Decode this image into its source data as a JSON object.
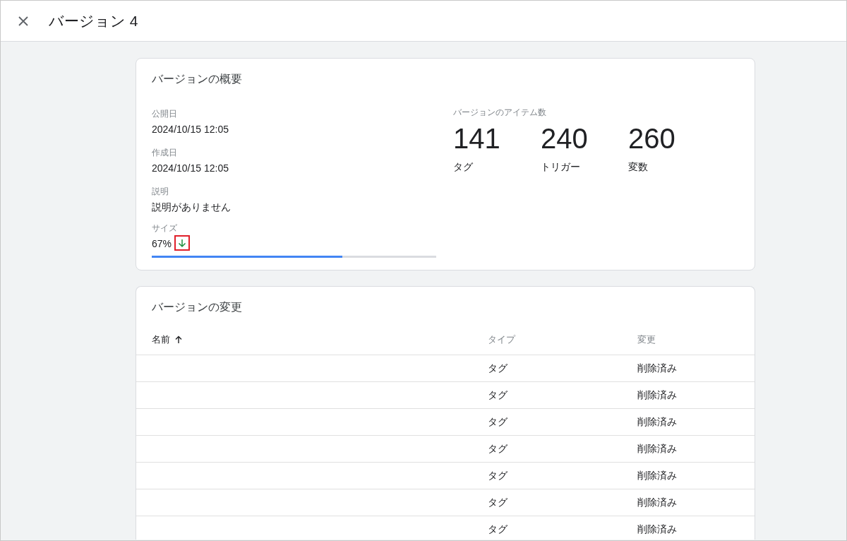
{
  "header": {
    "title": "バージョン 4"
  },
  "summary": {
    "title": "バージョンの概要",
    "fields": [
      {
        "label": "公開日",
        "value": "2024/10/15 12:05"
      },
      {
        "label": "作成日",
        "value": "2024/10/15 12:05"
      },
      {
        "label": "説明",
        "value": "説明がありません"
      }
    ],
    "size": {
      "label": "サイズ",
      "reading": "67%",
      "level": 0.67,
      "highlighted": true
    },
    "items": {
      "label": "バージョンのアイテム数",
      "counts": [
        {
          "value": "141",
          "label": "タグ"
        },
        {
          "value": "240",
          "label": "トリガー"
        },
        {
          "value": "260",
          "label": "変数"
        }
      ]
    }
  },
  "changes": {
    "title": "バージョンの変更",
    "columns": [
      {
        "label": "名前",
        "sorted": true
      },
      {
        "label": "タイプ"
      },
      {
        "label": "変更"
      }
    ],
    "rows": [
      {
        "type": "タグ",
        "change": "削除済み"
      },
      {
        "type": "タグ",
        "change": "削除済み"
      },
      {
        "type": "タグ",
        "change": "削除済み"
      },
      {
        "type": "タグ",
        "change": "削除済み"
      },
      {
        "type": "タグ",
        "change": "削除済み"
      },
      {
        "type": "タグ",
        "change": "削除済み"
      },
      {
        "type": "タグ",
        "change": "削除済み"
      }
    ]
  }
}
